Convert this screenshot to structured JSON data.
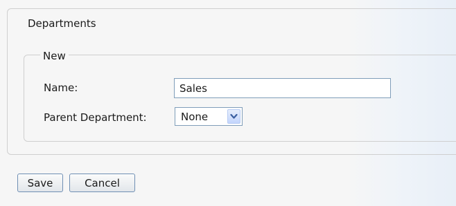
{
  "departments": {
    "legend": "Departments",
    "new_section": {
      "legend": "New",
      "name_label": "Name:",
      "name_value": "Sales",
      "parent_label": "Parent Department:",
      "parent_selected": "None"
    }
  },
  "buttons": {
    "save_label": "Save",
    "cancel_label": "Cancel"
  },
  "icons": {
    "dropdown": "chevron-down-icon"
  },
  "colors": {
    "input_border": "#7f9db9",
    "button_border": "#6f8fb4",
    "fieldset_border": "#cfcfcf",
    "page_background": "#f6f6f6"
  }
}
